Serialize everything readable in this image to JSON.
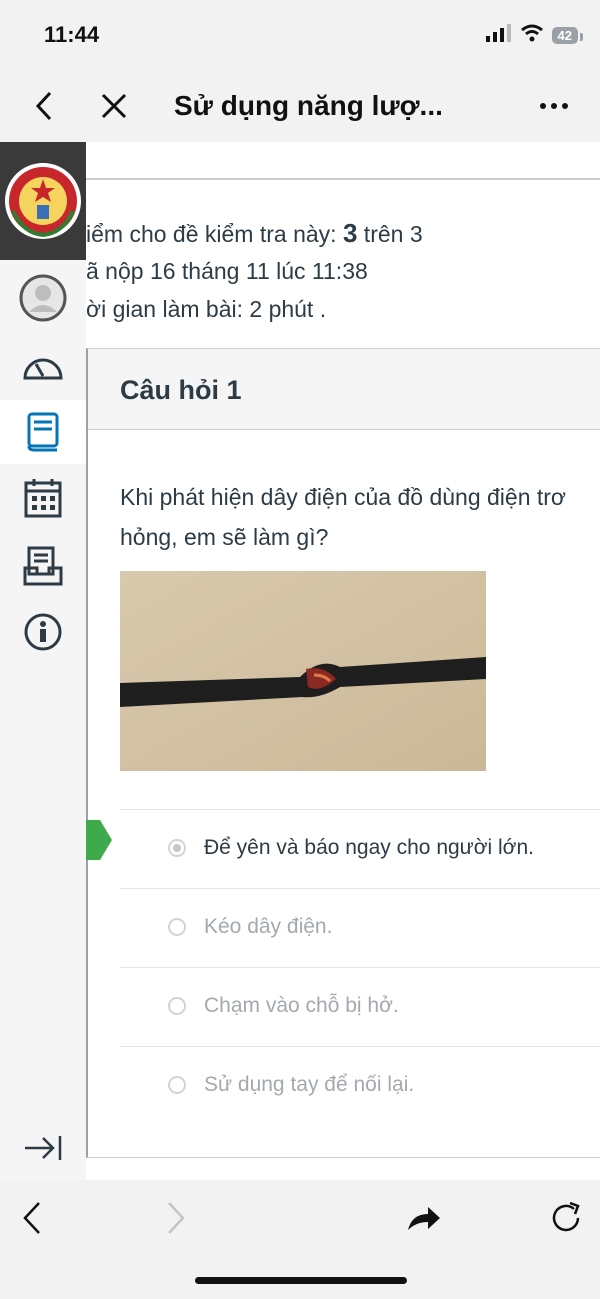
{
  "status": {
    "time": "11:44",
    "battery": "42"
  },
  "nav": {
    "title": "Sử dụng năng lượ..."
  },
  "sidebar": {
    "items": [
      "profile",
      "dashboard",
      "courses",
      "calendar",
      "inbox",
      "help"
    ]
  },
  "quiz": {
    "score_prefix": "iểm cho đề kiểm tra này: ",
    "score": "3",
    "score_suffix": " trên 3",
    "submitted": "ã nộp 16 tháng 11 lúc 11:38",
    "time_spent": "ời gian làm bài: 2 phút ."
  },
  "question": {
    "title": "Câu hỏi 1",
    "text_line1": "Khi phát hiện dây điện của đồ dùng điện trơ",
    "text_line2": "hỏng, em sẽ làm gì?",
    "answers": [
      {
        "text": "Để yên và báo ngay cho người lớn.",
        "selected": true
      },
      {
        "text": "Kéo dây điện.",
        "selected": false
      },
      {
        "text": "Chạm vào chỗ bị hở.",
        "selected": false
      },
      {
        "text": "Sử dụng tay để nối lại.",
        "selected": false
      }
    ]
  },
  "colors": {
    "correct": "#3eaa4b",
    "active_icon": "#0374b5",
    "text": "#2d3b45"
  }
}
